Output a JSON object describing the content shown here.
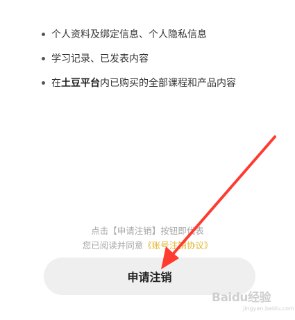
{
  "info_list": {
    "items": [
      {
        "text": "个人资料及绑定信息、个人隐私信息"
      },
      {
        "text": "学习记录、已发表内容"
      },
      {
        "prefix": "在",
        "bold": "土豆平台",
        "suffix": "内已购买的全部课程和产品内容"
      }
    ]
  },
  "notice": {
    "line1": "点击【申请注销】按钮即代表",
    "line2_prefix": "您已阅读并同意",
    "agreement_link": "《账号注销协议》"
  },
  "apply_button": {
    "label": "申请注销"
  },
  "annotation": {
    "arrow_color": "#ff3b30"
  },
  "watermark": {
    "logo": "Baidu经验",
    "subtext": "jingyan.baidu.com"
  },
  "colors": {
    "link": "#e3b52f",
    "button_bg": "#efefef",
    "notice_text": "#a6a6a6"
  }
}
